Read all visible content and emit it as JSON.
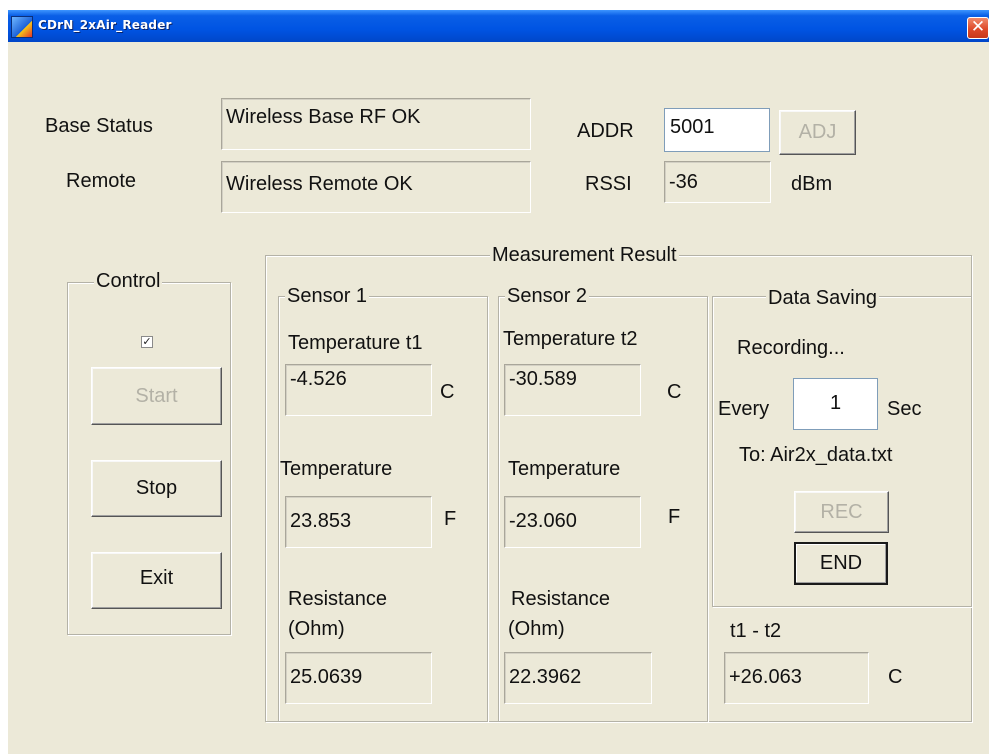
{
  "window": {
    "title": "CDrN_2xAir_Reader",
    "close_glyph": "✕"
  },
  "status": {
    "base_label": "Base Status",
    "base_value": "Wireless Base RF OK",
    "remote_label": "Remote",
    "remote_value": "Wireless Remote OK",
    "addr_label": "ADDR",
    "addr_value": "5001",
    "adj_button": "ADJ",
    "rssi_label": "RSSI",
    "rssi_value": "-36",
    "rssi_unit": "dBm"
  },
  "control": {
    "title": "Control",
    "checkbox_checked": true,
    "checkbox_mark": "✓",
    "start_button": "Start",
    "stop_button": "Stop",
    "exit_button": "Exit"
  },
  "measurement": {
    "title": "Measurement Result",
    "sensor1": {
      "title": "Sensor 1",
      "temp_c_label": "Temperature t1",
      "temp_c_value": "-4.526",
      "temp_c_unit": "C",
      "temp_f_label": "Temperature",
      "temp_f_value": "23.853",
      "temp_f_unit": "F",
      "resistance_label": "Resistance",
      "resistance_unit_label": "(Ohm)",
      "resistance_value": "25.0639"
    },
    "sensor2": {
      "title": "Sensor 2",
      "temp_c_label": "Temperature t2",
      "temp_c_value": "-30.589",
      "temp_c_unit": "C",
      "temp_f_label": "Temperature",
      "temp_f_value": "-23.060",
      "temp_f_unit": "F",
      "resistance_label": "Resistance",
      "resistance_unit_label": "(Ohm)",
      "resistance_value": "22.3962"
    },
    "data_saving": {
      "title": "Data Saving",
      "status": "Recording...",
      "every_label": "Every",
      "interval_value": "1",
      "interval_unit": "Sec",
      "target": "To: Air2x_data.txt",
      "rec_button": "REC",
      "end_button": "END"
    },
    "difference": {
      "label": "t1 - t2",
      "value": "+26.063",
      "unit": "C"
    }
  },
  "colors": {
    "titlebar": "#0054e3",
    "window_bg": "#ece9d8",
    "close_button": "#de4a2a",
    "disabled_text": "#b3b1a6"
  }
}
